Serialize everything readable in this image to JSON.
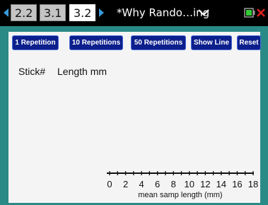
{
  "tabs": [
    {
      "label": "2.2"
    },
    {
      "label": "3.1"
    },
    {
      "label": "3.2"
    }
  ],
  "document_title": "*Why Rando…ing",
  "buttons": {
    "one_repetition": "1 Repetition",
    "ten_repetitions": "10 Repetitions",
    "fifty_repetitions": "50 Repetitions",
    "show_line": "Show Line",
    "reset": "Reset"
  },
  "table": {
    "col_stick": "Stick#",
    "col_length": "Length mm"
  },
  "axis": {
    "ticks": [
      "0",
      "2",
      "4",
      "6",
      "8",
      "10",
      "12",
      "14",
      "16",
      "18"
    ],
    "title": "mean samp length (mm)",
    "min": 0,
    "max": 18,
    "minor_step": 1
  },
  "colors": {
    "titlebar": "#000000",
    "panel": "#2a8a86",
    "button": "#0c1f8c",
    "nav_arrow": "#3a9ad9"
  },
  "icons": {
    "nav_left": "triangle-left",
    "nav_right": "triangle-right",
    "dropdown": "chevron-down",
    "battery": "battery",
    "close": "close-x"
  }
}
